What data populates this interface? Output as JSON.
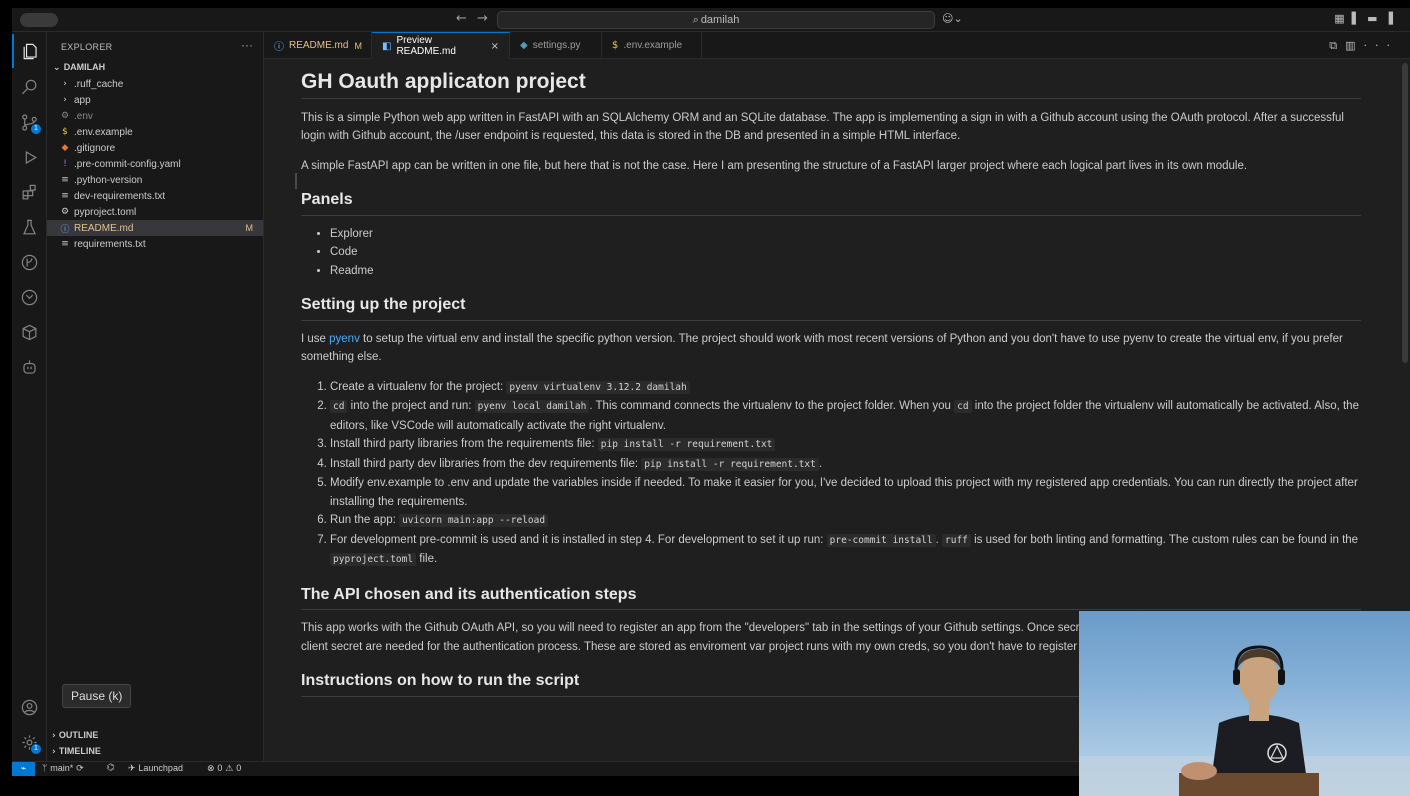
{
  "titlebar": {
    "search": "damilah"
  },
  "tooltip": "Pause (k)",
  "sidebar": {
    "title": "EXPLORER",
    "folder": "DAMILAH",
    "items": [
      {
        "label": ".ruff_cache",
        "icon": "chevron-right-icon",
        "glyph": "›"
      },
      {
        "label": "app",
        "icon": "chevron-right-icon",
        "glyph": "›"
      },
      {
        "label": ".env",
        "icon": "gear-icon",
        "glyph": "⚙"
      },
      {
        "label": ".env.example",
        "icon": "dollar-icon",
        "glyph": "$"
      },
      {
        "label": ".gitignore",
        "icon": "diamond-icon",
        "glyph": "◆"
      },
      {
        "label": ".pre-commit-config.yaml",
        "icon": "exclamation-icon",
        "glyph": "!"
      },
      {
        "label": ".python-version",
        "icon": "lines-icon",
        "glyph": "≡"
      },
      {
        "label": "dev-requirements.txt",
        "icon": "lines-icon",
        "glyph": "≡"
      },
      {
        "label": "pyproject.toml",
        "icon": "gear-icon",
        "glyph": "⚙"
      },
      {
        "label": "README.md",
        "icon": "info-icon",
        "glyph": "ⓘ",
        "mark": "M"
      },
      {
        "label": "requirements.txt",
        "icon": "lines-icon",
        "glyph": "≡"
      }
    ],
    "outline": "OUTLINE",
    "timeline": "TIMELINE"
  },
  "tabs": [
    {
      "label": "README.md",
      "mark": "M",
      "icon": "ⓘ",
      "color": "#e2c08d"
    },
    {
      "label": "Preview README.md",
      "icon": "◧",
      "color": "#75beff",
      "close": "×"
    },
    {
      "label": "settings.py",
      "icon": "◆",
      "color": "#519aba"
    },
    {
      "label": ".env.example",
      "icon": "$",
      "color": "#e8c547"
    }
  ],
  "readme": {
    "title": "GH Oauth applicaton project",
    "intro": "This is a simple Python web app written in FastAPI with an SQLAlchemy ORM and an SQLite database. The app is implementing a sign in with a Github account using the OAuth protocol. After a successful login with Github account, the /user endpoint is requested, this data is stored in the DB and presented in a simple HTML interface.",
    "intro2": "A simple FastAPI app can be written in one file, but here that is not the case. Here I am presenting the structure of a FastAPI larger project where each logical part lives in its own module.",
    "panels_h": "Panels",
    "panels": [
      "Explorer",
      "Code",
      "Readme"
    ],
    "setup_h": "Setting up the project",
    "setup_p_pre": "I use ",
    "setup_link": "pyenv",
    "setup_p_post": " to setup the virtual env and install the specific python version. The project should work with most recent versions of Python and you don't have to use pyenv to create the virtual env, if you prefer something else.",
    "steps": {
      "s1a": "Create a virtualenv for the project: ",
      "s1c": "pyenv virtualenv 3.12.2 damilah",
      "s2c1": "cd",
      "s2a": " into the project and run: ",
      "s2c2": "pyenv local damilah",
      "s2b": ". This command connects the virtualenv to the project folder. When you ",
      "s2c3": "cd",
      "s2d": " into the project folder the virtualenv will automatically be activated. Also, the editors, like VSCode will automatically activate the right virtualenv.",
      "s3a": "Install third party libraries from the requirements file: ",
      "s3c": "pip install -r requirement.txt",
      "s4a": "Install third party dev libraries from the dev requirements file: ",
      "s4c": "pip install -r requirement.txt",
      "s4b": ".",
      "s5": "Modify env.example to .env and update the variables inside if needed. To make it easier for you, I've decided to upload this project with my registered app credentials. You can run directly the project after installing the requirements.",
      "s6a": "Run the app: ",
      "s6c": "uvicorn main:app --reload",
      "s7a": "For development pre-commit is used and it is installed in step 4. For development to set it up run: ",
      "s7c1": "pre-commit install",
      "s7b": ". ",
      "s7c2": "ruff",
      "s7d": " is used for both linting and formatting. The custom rules can be found in the ",
      "s7c3": "pyproject.toml",
      "s7e": " file."
    },
    "api_h": "The API chosen and its authentication steps",
    "api_p": "This app works with the Github OAuth API, so you will need to register an app from the \"developers\" tab in the settings of your Github settings. Once secret\" and store it in a safe place. The app client id and client secret are needed for the authentication process. These are stored as enviroment var project runs with my own creds, so you don't have to register the Github app.",
    "run_h": "Instructions on how to run the script"
  },
  "statusbar": {
    "branch": "main*",
    "launchpad": "Launchpad",
    "errors": "0",
    "warnings": "0"
  },
  "colors": {
    "accent": "#0078d4",
    "modified": "#e2c08d",
    "link": "#4daafc"
  }
}
